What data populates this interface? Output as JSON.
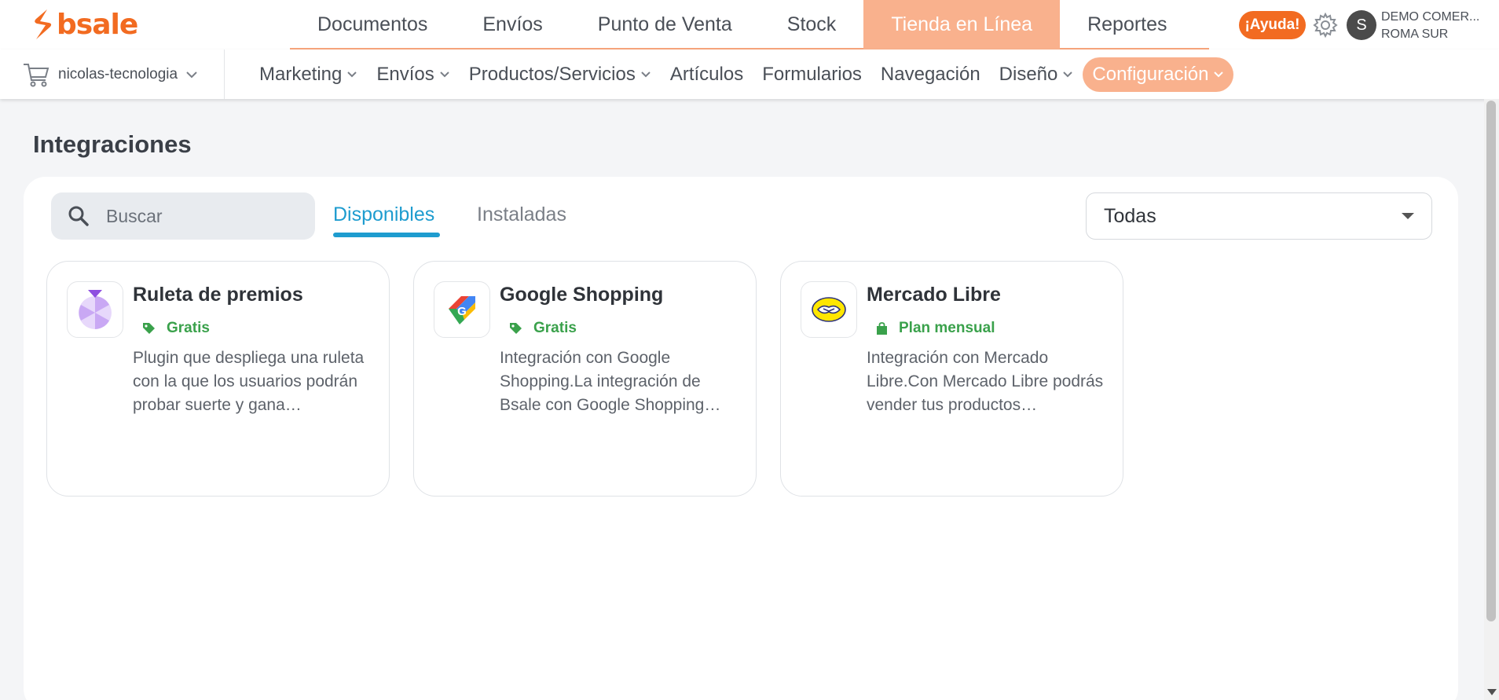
{
  "brand": {
    "name": "bsale",
    "color": "#f26b21"
  },
  "main_nav": [
    {
      "label": "Documentos",
      "active": false
    },
    {
      "label": "Envíos",
      "active": false
    },
    {
      "label": "Punto de Venta",
      "active": false
    },
    {
      "label": "Stock",
      "active": false
    },
    {
      "label": "Tienda en Línea",
      "active": true
    },
    {
      "label": "Reportes",
      "active": false
    }
  ],
  "header": {
    "help_label": "¡Ayuda!",
    "avatar_initial": "S",
    "user_line1": "DEMO COMER...",
    "user_line2": "ROMA SUR"
  },
  "store": {
    "name": "nicolas-tecnologia"
  },
  "sub_nav": [
    {
      "label": "Marketing",
      "dropdown": true
    },
    {
      "label": "Envíos",
      "dropdown": true
    },
    {
      "label": "Productos/Servicios",
      "dropdown": true
    },
    {
      "label": "Artículos",
      "dropdown": false
    },
    {
      "label": "Formularios",
      "dropdown": false
    },
    {
      "label": "Navegación",
      "dropdown": false
    },
    {
      "label": "Diseño",
      "dropdown": true
    },
    {
      "label": "Configuración",
      "dropdown": true,
      "active": true
    }
  ],
  "page": {
    "title": "Integraciones"
  },
  "toolbar": {
    "search_placeholder": "Buscar",
    "tab_available": "Disponibles",
    "tab_installed": "Instaladas",
    "filter_value": "Todas"
  },
  "integrations": [
    {
      "title": "Ruleta de premios",
      "badge": "Gratis",
      "badge_icon": "tag-icon",
      "icon": "prize-wheel-icon",
      "description": "Plugin que despliega una ruleta con la que los usuarios podrán probar suerte y gana…"
    },
    {
      "title": "Google Shopping",
      "badge": "Gratis",
      "badge_icon": "tag-icon",
      "icon": "google-shopping-icon",
      "description": "Integración con Google Shopping.La integración de Bsale con Google Shopping…"
    },
    {
      "title": "Mercado Libre",
      "badge": "Plan mensual",
      "badge_icon": "shopping-bag-icon",
      "icon": "mercado-libre-icon",
      "description": "Integración con Mercado Libre.Con Mercado Libre podrás vender tus productos…"
    }
  ],
  "colors": {
    "accent_orange": "#f26b21",
    "active_tab_bg": "#f9b18d",
    "tab_blue": "#1e9ccf",
    "badge_green": "#3aa14b"
  }
}
